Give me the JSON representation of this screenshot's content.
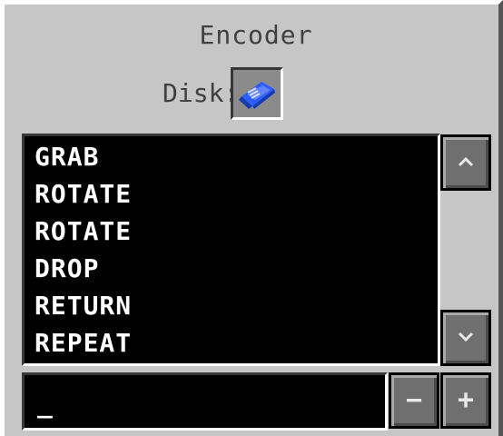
{
  "window": {
    "title": "Encoder"
  },
  "disk": {
    "label": "Disk:",
    "icon": "blue-floppy-disk-icon"
  },
  "program": {
    "instructions": [
      "GRAB",
      "ROTATE",
      "ROTATE",
      "DROP",
      "RETURN",
      "REPEAT"
    ]
  },
  "controls": {
    "scroll_up_icon": "chevron-up-icon",
    "scroll_down_icon": "chevron-down-icon",
    "remove_label": "−",
    "add_label": "+"
  },
  "input": {
    "cursor": "_"
  },
  "colors": {
    "panel": "#c6c6c6",
    "text": "#404040",
    "list_background": "#000000",
    "list_text": "#ffffff",
    "button": "#6f6f6f",
    "disk_blue": "#2f5cff"
  }
}
